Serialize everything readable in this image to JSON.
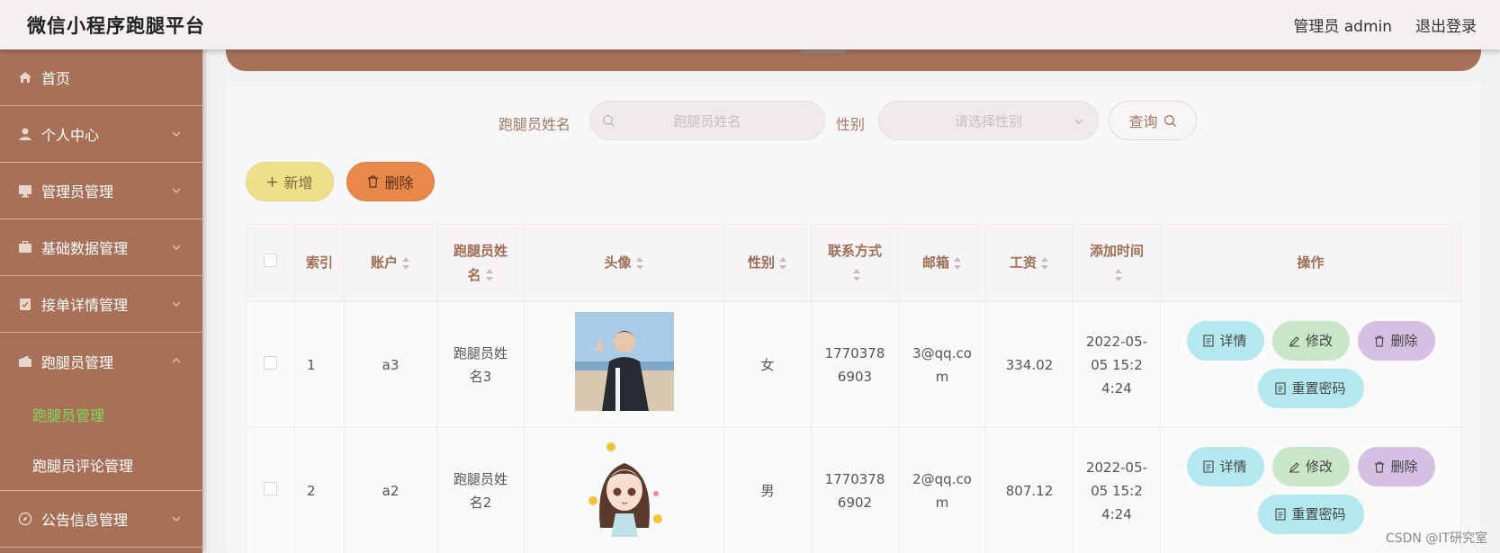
{
  "header": {
    "title": "微信小程序跑腿平台",
    "admin_label": "管理员 admin",
    "logout_label": "退出登录"
  },
  "sidebar": {
    "items": [
      {
        "label": "首页",
        "icon": "home-icon"
      },
      {
        "label": "个人中心",
        "icon": "user-icon"
      },
      {
        "label": "管理员管理",
        "icon": "monitor-icon"
      },
      {
        "label": "基础数据管理",
        "icon": "briefcase-icon"
      },
      {
        "label": "接单详情管理",
        "icon": "clipboard-icon"
      },
      {
        "label": "跑腿员管理",
        "icon": "wallet-icon"
      }
    ],
    "subitems": [
      {
        "label": "跑腿员管理",
        "active": true
      },
      {
        "label": "跑腿员评论管理",
        "active": false
      }
    ],
    "bottom_item": {
      "label": "公告信息管理",
      "icon": "compass-icon"
    }
  },
  "search": {
    "name_label": "跑腿员姓名",
    "name_placeholder": "跑腿员姓名",
    "gender_label": "性别",
    "gender_placeholder": "请选择性别",
    "query_label": "查询"
  },
  "actions": {
    "add_label": "新增",
    "delete_label": "删除"
  },
  "table": {
    "headers": {
      "index": "索引",
      "account": "账户",
      "name": "跑腿员姓名",
      "avatar": "头像",
      "gender": "性别",
      "contact": "联系方式",
      "email": "邮箱",
      "salary": "工资",
      "added": "添加时间",
      "ops": "操作"
    },
    "rows": [
      {
        "index": "1",
        "account": "a3",
        "name": "跑腿员姓名3",
        "gender": "女",
        "contact": "17703786903",
        "email": "3@qq.com",
        "salary": "334.02",
        "added": "2022-05-05 15:24:24"
      },
      {
        "index": "2",
        "account": "a2",
        "name": "跑腿员姓名2",
        "gender": "男",
        "contact": "17703786902",
        "email": "2@qq.com",
        "salary": "807.12",
        "added": "2022-05-05 15:24:24"
      }
    ],
    "op_labels": {
      "detail": "详情",
      "edit": "修改",
      "remove": "删除",
      "reset": "重置密码"
    }
  },
  "watermark": "CSDN @IT研究室",
  "colors": {
    "sidebar": "#a87157",
    "active_submenu": "#7ed957",
    "add_button": "#ede08a",
    "delete_button": "#e8884a"
  }
}
